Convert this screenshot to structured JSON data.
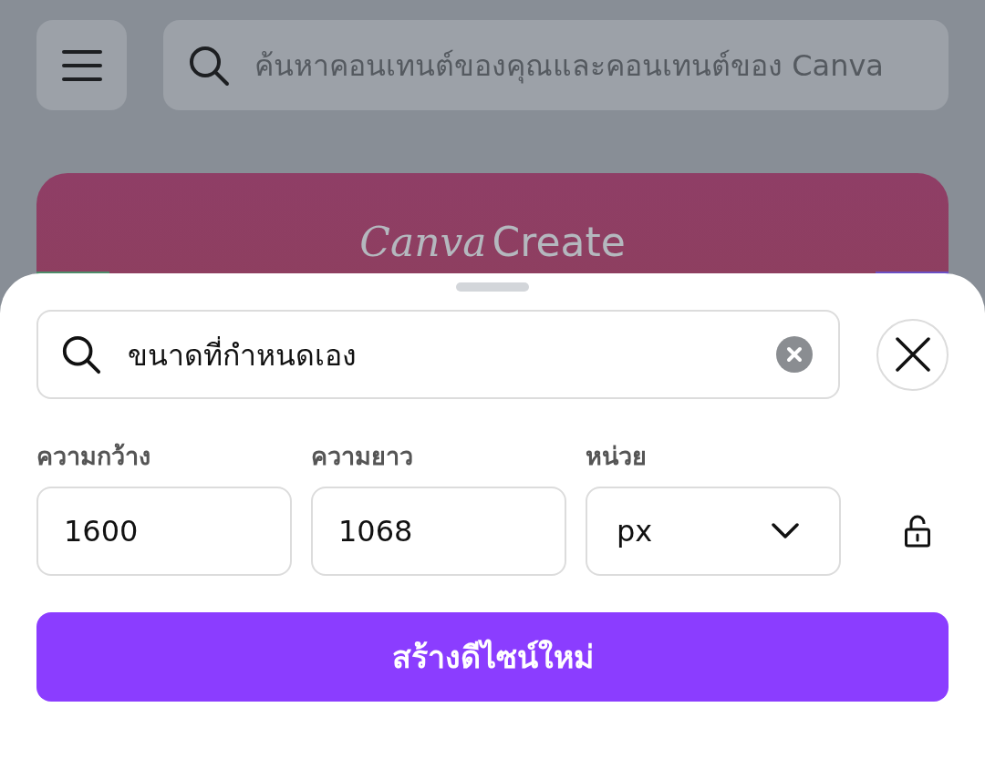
{
  "background_page": {
    "search": {
      "placeholder": "ค้นหาคอนเทนต์ของคุณและคอนเทนต์ของ Canva"
    },
    "banner": {
      "logo_script": "Canva",
      "logo_text": "Create"
    }
  },
  "sheet": {
    "search": {
      "value": "ขนาดที่กำหนดเอง"
    },
    "fields": [
      {
        "label": "ความกว้าง",
        "kind": "number",
        "value": "1600"
      },
      {
        "label": "ความยาว",
        "kind": "number",
        "value": "1068"
      },
      {
        "label": "หน่วย",
        "kind": "dropdown",
        "value": "px"
      }
    ],
    "aspect_locked": false,
    "create_button": "สร้างดีไซน์ใหม่"
  }
}
